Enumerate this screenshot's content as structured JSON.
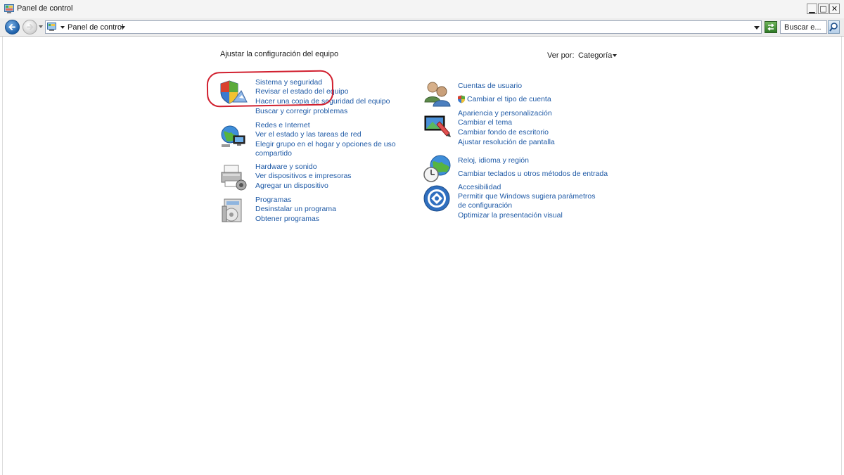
{
  "window": {
    "title": "Panel de control",
    "minimize": "▁",
    "maximize": "□",
    "close": "✕"
  },
  "address_bar": {
    "path": "Panel de control",
    "search_placeholder": "Buscar e..."
  },
  "main": {
    "heading": "Ajustar la configuración del equipo",
    "view_by_label": "Ver por:",
    "view_by_value": "Categoría"
  },
  "left_categories": [
    {
      "icon": "shield-icon",
      "title": "Sistema y seguridad",
      "links": [
        "Revisar el estado del equipo",
        "Hacer una copia de seguridad del equipo",
        "Buscar y corregir problemas"
      ]
    },
    {
      "icon": "network-icon",
      "title": "Redes e Internet",
      "links": [
        "Ver el estado y las tareas de red",
        "Elegir grupo en el hogar y opciones de uso compartido"
      ]
    },
    {
      "icon": "printer-icon",
      "title": "Hardware y sonido",
      "links": [
        "Ver dispositivos e impresoras",
        "Agregar un dispositivo"
      ]
    },
    {
      "icon": "programs-icon",
      "title": "Programas",
      "links": [
        "Desinstalar un programa",
        "Obtener programas"
      ]
    }
  ],
  "right_categories": [
    {
      "icon": "users-icon",
      "title": "Cuentas de usuario",
      "links": [
        "Cambiar el tipo de cuenta"
      ]
    },
    {
      "icon": "appearance-icon",
      "title": "Apariencia y personalización",
      "links": [
        "Cambiar el tema",
        "Cambiar fondo de escritorio",
        "Ajustar resolución de pantalla"
      ]
    },
    {
      "icon": "clock-globe-icon",
      "title": "Reloj, idioma y región",
      "links": [
        "Cambiar teclados u otros métodos de entrada"
      ]
    },
    {
      "icon": "accessibility-icon",
      "title": "Accesibilidad",
      "links": [
        "Permitir que Windows sugiera parámetros de configuración",
        "Optimizar la presentación visual"
      ]
    }
  ],
  "colors": {
    "link": "#1f5aa6",
    "highlight": "#d1202f"
  }
}
